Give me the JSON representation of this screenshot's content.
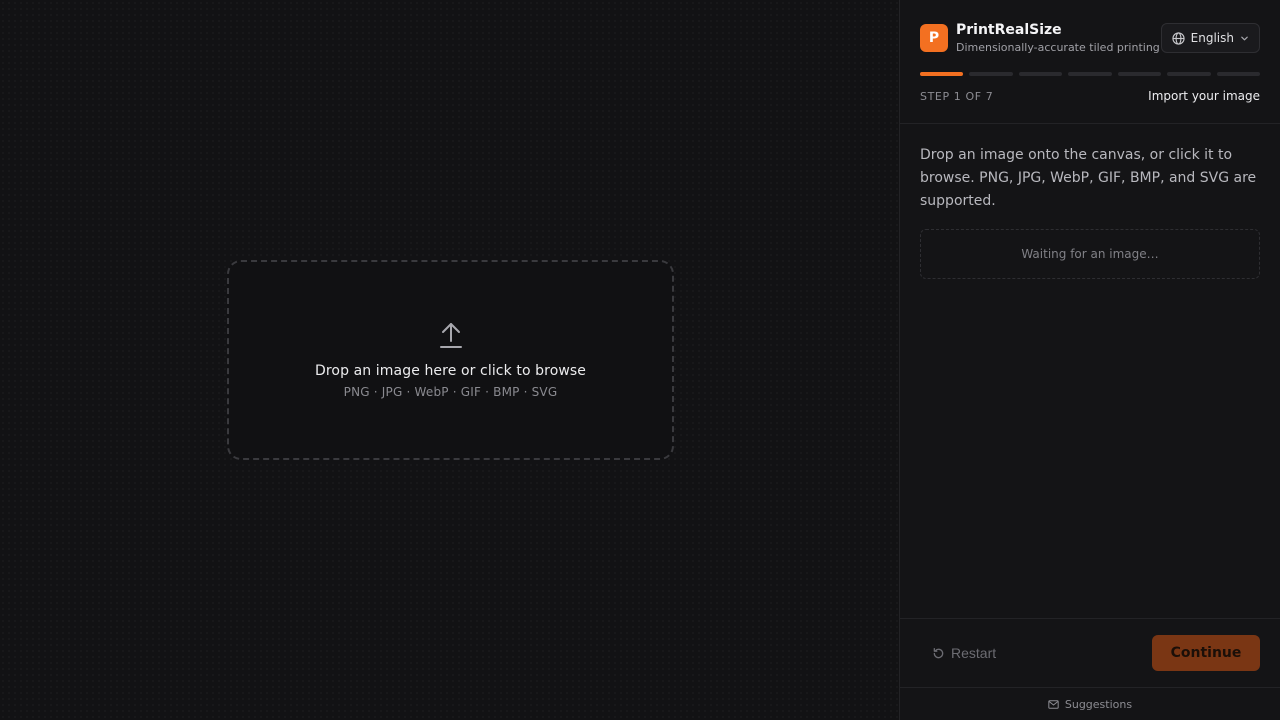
{
  "canvas": {
    "dropzone": {
      "icon": "upload-arrow-icon",
      "title": "Drop an image here or click to browse",
      "formats": "PNG · JPG · WebP · GIF · BMP · SVG"
    }
  },
  "panel": {
    "logo_letter": "P",
    "app_name": "PrintRealSize",
    "tagline": "Dimensionally-accurate tiled printing",
    "language": {
      "icon": "globe-icon",
      "label": "English",
      "chevron": "chevron-down-icon"
    },
    "progress": {
      "current": 1,
      "total": 7
    },
    "step_label": "STEP 1 OF 7",
    "step_title": "Import your image",
    "description": "Drop an image onto the canvas, or click it to browse. PNG, JPG, WebP, GIF, BMP, and SVG are supported.",
    "waiting_text": "Waiting for an image…",
    "footer": {
      "restart_icon": "restart-icon",
      "restart_label": "Restart",
      "continue_label": "Continue"
    },
    "suggestions": {
      "icon": "mail-icon",
      "label": "Suggestions"
    }
  },
  "colors": {
    "accent": "#f37021",
    "continue_disabled": "#7a3614",
    "background": "#121214",
    "panel": "#141416"
  }
}
